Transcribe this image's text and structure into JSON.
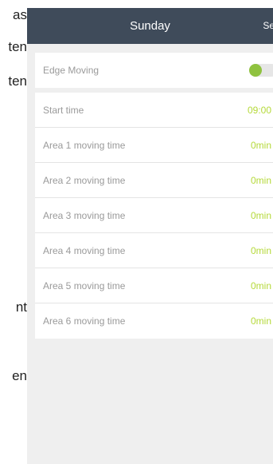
{
  "side_text": [
    "as",
    "ten",
    "ten",
    "nt",
    "en"
  ],
  "header": {
    "title": "Sunday",
    "action_label": "Se"
  },
  "edge_moving": {
    "label": "Edge Moving",
    "enabled": true
  },
  "start_time": {
    "label": "Start time",
    "value": "09:00"
  },
  "areas": [
    {
      "label": "Area 1 moving time",
      "value": "0min"
    },
    {
      "label": "Area 2 moving time",
      "value": "0min"
    },
    {
      "label": "Area 3 moving time",
      "value": "0min"
    },
    {
      "label": "Area 4 moving time",
      "value": "0min"
    },
    {
      "label": "Area 5 moving time",
      "value": "0min"
    },
    {
      "label": "Area 6 moving time",
      "value": "0min"
    }
  ],
  "colors": {
    "header": "#3f4b5a",
    "accent": "#8fc23f",
    "value": "#b5d93a"
  }
}
